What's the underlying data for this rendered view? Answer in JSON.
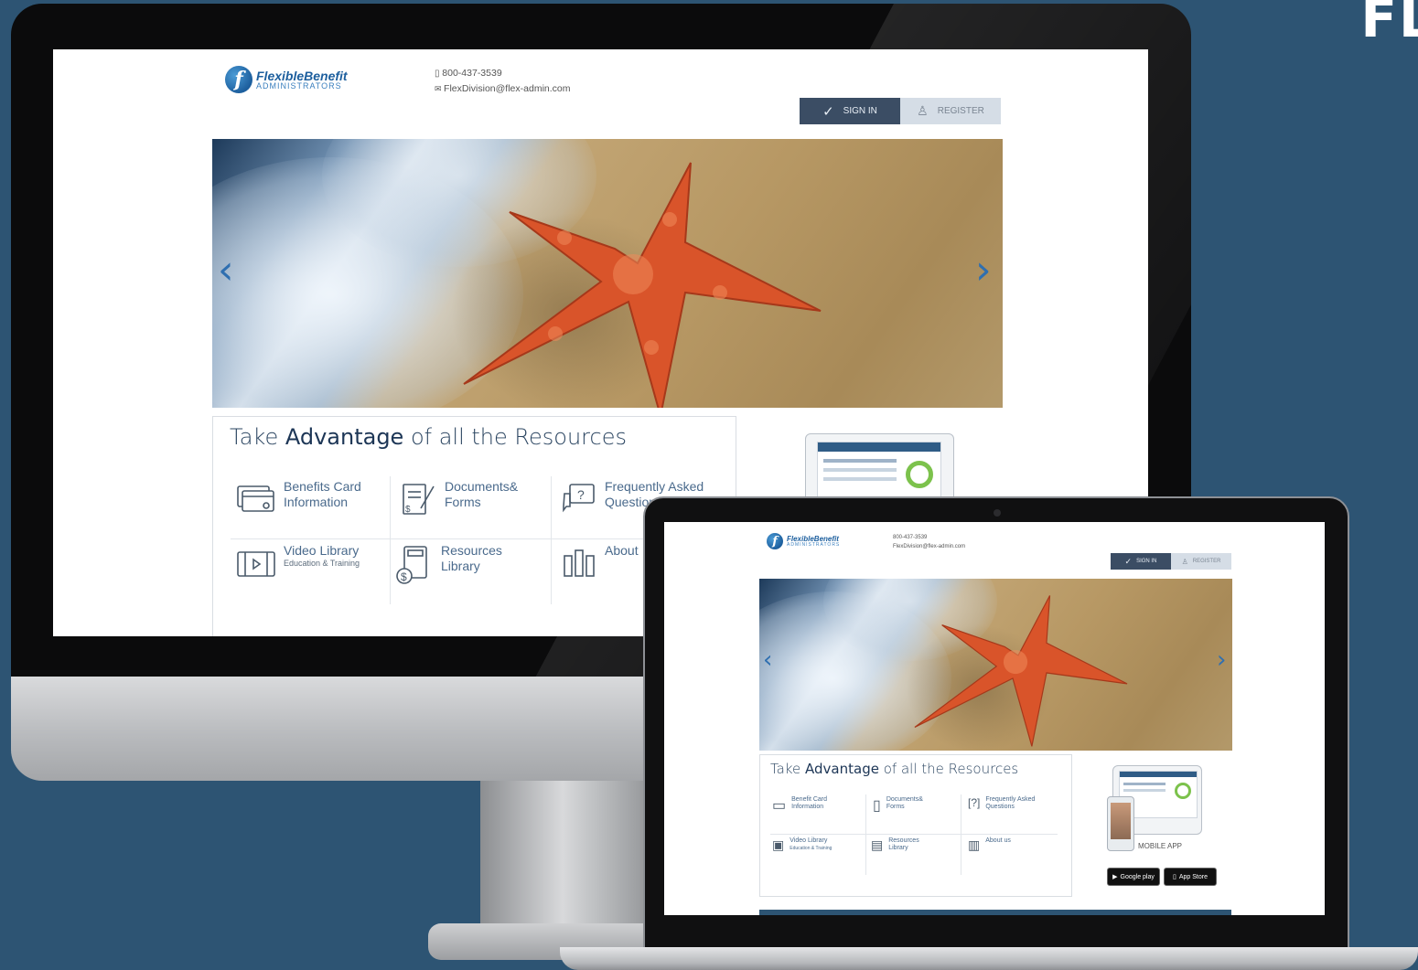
{
  "corner": {
    "text": "FL"
  },
  "site": {
    "logo": {
      "mark": "f",
      "name": "FlexibleBenefit",
      "sub": "ADMINISTRATORS"
    },
    "contact": {
      "phone": "800-437-3539",
      "email": "FlexDivision@flex-admin.com"
    },
    "auth": {
      "signin_label": "SIGN IN",
      "register_label": "REGISTER"
    },
    "hero": {
      "prev_arrow": "‹",
      "next_arrow": "›"
    },
    "resources": {
      "title_plain_1": "Take ",
      "title_bold": "Advantage",
      "title_plain_2": " of all the Resources",
      "items": [
        {
          "label_line1": "Benefits Card",
          "label_line2": "Information",
          "sub": "",
          "icon": "credit-card-icon"
        },
        {
          "label_line1": "Documents&",
          "label_line2": "Forms",
          "sub": "",
          "icon": "document-icon"
        },
        {
          "label_line1": "Frequently Asked",
          "label_line2": "Questions",
          "sub": "",
          "icon": "question-chat-icon"
        },
        {
          "label_line1": "Video Library",
          "label_line2": "",
          "sub": "Education & Training",
          "icon": "video-icon"
        },
        {
          "label_line1": "Resources",
          "label_line2": "Library",
          "sub": "",
          "icon": "calculator-icon"
        },
        {
          "label_line1": "About",
          "label_line2": "",
          "sub": "",
          "icon": "about-icon"
        }
      ]
    }
  },
  "laptop_site": {
    "contact": {
      "phone": "800-437-3539",
      "email": "FlexDivision@flex-admin.com"
    },
    "auth": {
      "signin_label": "SIGN IN",
      "register_label": "REGISTER"
    },
    "resources": {
      "title_plain_1": "Take ",
      "title_bold": "Advantage",
      "title_plain_2": " of all the Resources",
      "items": [
        {
          "label_line1": "Benefit Card",
          "label_line2": "Information"
        },
        {
          "label_line1": "Documents&",
          "label_line2": "Forms"
        },
        {
          "label_line1": "Frequently Asked",
          "label_line2": "Questions"
        },
        {
          "label_line1": "Video Library",
          "label_line2": "Education & Training"
        },
        {
          "label_line1": "Resources",
          "label_line2": "Library"
        },
        {
          "label_line1": "About us",
          "label_line2": ""
        }
      ]
    },
    "mobile_app_label": "MOBILE APP",
    "google_play": "Google play",
    "app_store": "App Store"
  }
}
